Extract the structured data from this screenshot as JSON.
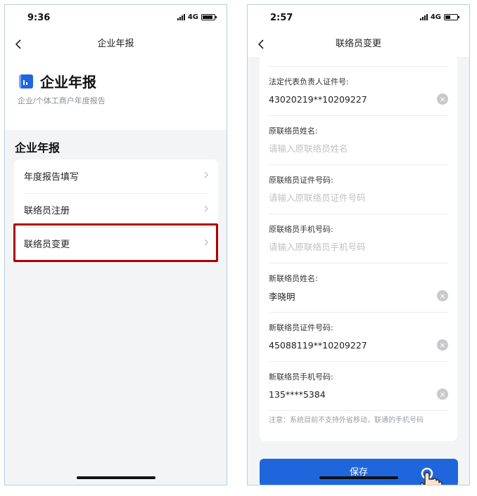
{
  "phone1": {
    "status": {
      "time": "9:36",
      "network": "4G"
    },
    "nav": {
      "title": "企业年报"
    },
    "hero": {
      "title": "企业年报",
      "subtitle": "企业/个体工商户年度报告",
      "logo_icon": "chart-bar-icon"
    },
    "section_title": "企业年报",
    "menu": [
      {
        "label": "年度报告填写"
      },
      {
        "label": "联络员注册"
      },
      {
        "label": "联络员变更",
        "highlighted": true
      }
    ],
    "highlight_color": "#b00000"
  },
  "phone2": {
    "status": {
      "time": "2:57",
      "network": "4G"
    },
    "nav": {
      "title": "联络员变更"
    },
    "fields": [
      {
        "label": "法定代表负责人证件号:",
        "value": "43020219**10209227",
        "placeholder": ""
      },
      {
        "label": "原联络员姓名:",
        "value": "",
        "placeholder": "请输入原联络员姓名"
      },
      {
        "label": "原联络员证件号码:",
        "value": "",
        "placeholder": "请输入原联络员证件号码"
      },
      {
        "label": "原联络员手机号码:",
        "value": "",
        "placeholder": "请输入原联络员手机号码"
      },
      {
        "label": "新联络员姓名:",
        "value": "李晓明",
        "placeholder": ""
      },
      {
        "label": "新联络员证件号码:",
        "value": "45088119**10209227",
        "placeholder": ""
      },
      {
        "label": "新联络员手机号码:",
        "value": "135****5384",
        "placeholder": ""
      }
    ],
    "note": "注意：系统目前不支持外省移动，联通的手机号码",
    "save_label": "保存",
    "accent_color": "#1f66dd"
  }
}
